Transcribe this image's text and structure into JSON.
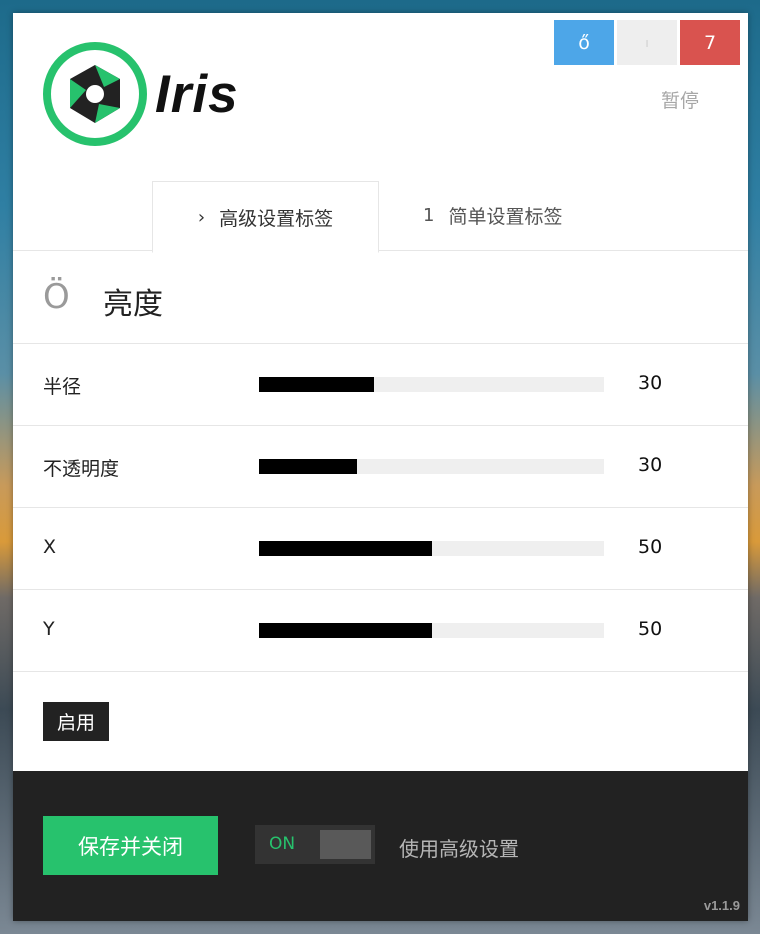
{
  "window_controls": {
    "minimize": "ő",
    "middle": "ı",
    "close": "7"
  },
  "pause_label": "暂停",
  "logo": {
    "text": "Iris"
  },
  "tabs": [
    {
      "icon": "›",
      "label": "高级设置标签"
    },
    {
      "icon": "1",
      "label": "简单设置标签"
    }
  ],
  "section": {
    "icon": "Ö",
    "title": "亮度"
  },
  "sliders": [
    {
      "label": "半径",
      "value": "30",
      "fill_fraction": 0.333
    },
    {
      "label": "不透明度",
      "value": "30",
      "fill_fraction": 0.284
    },
    {
      "label": "X",
      "value": "50",
      "fill_fraction": 0.5
    },
    {
      "label": "Y",
      "value": "50",
      "fill_fraction": 0.5
    }
  ],
  "enable_label": "启用",
  "footer": {
    "save_label": "保存并关闭",
    "toggle_state": "ON",
    "toggle_label": "使用高级设置",
    "version": "v1.1.9"
  },
  "colors": {
    "accent_green": "#27c26d",
    "close_red": "#d9534f",
    "minimize_blue": "#4da6e8"
  }
}
